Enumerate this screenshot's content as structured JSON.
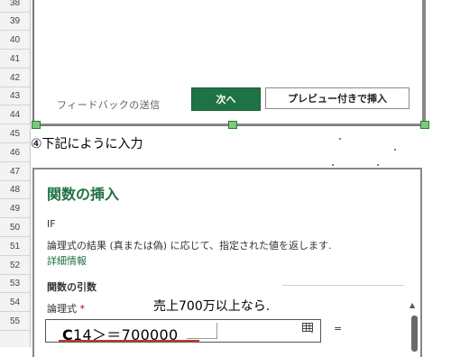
{
  "rows": [
    "38",
    "39",
    "40",
    "41",
    "42",
    "43",
    "44",
    "45",
    "46",
    "47",
    "48",
    "49",
    "50",
    "51",
    "52",
    "53",
    "54",
    "55"
  ],
  "dialog1": {
    "feedback_link": "フィードバックの送信",
    "next_button": "次へ",
    "insert_preview_button": "プレビュー付きで挿入"
  },
  "annotation_step": "④下記にように入力",
  "dialog2": {
    "title": "関数の挿入",
    "function_name": "IF",
    "description": "論理式の結果 (真または偽) に応じて、指定された値を返します.",
    "help_link": "詳細情報",
    "arguments_title": "関数の引数",
    "arg1_label": "論理式",
    "arg1_required_mark": "*",
    "arg1_value_prefix": "C",
    "arg1_value_rest": "14＞＝700000",
    "equals_sign": "=",
    "annotation_sales": "売上700万以上なら."
  },
  "colors": {
    "accent_green": "#1f7244",
    "underline_red": "#c0392b"
  }
}
